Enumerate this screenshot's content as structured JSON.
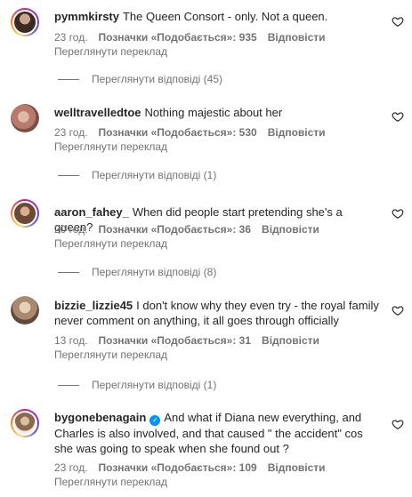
{
  "comments": [
    {
      "username": "pymmkirsty",
      "text": "The Queen Consort - only. Not a queen.",
      "time": "23 год.",
      "likes": "Позначки «Подобається»: 935",
      "reply": "Відповісти",
      "translate": "Переглянути переклад",
      "view_replies": "Переглянути відповіді (45)",
      "like_icon": "heart-outline-icon"
    },
    {
      "username": "welltravelledtoe",
      "text": "Nothing majestic about her",
      "time": "23 год.",
      "likes": "Позначки «Подобається»: 530",
      "reply": "Відповісти",
      "translate": "Переглянути переклад",
      "view_replies": "Переглянути відповіді (1)",
      "like_icon": "heart-outline-icon"
    },
    {
      "username": "aaron_fahey_",
      "text": "When did people start pretending she's a queen?",
      "time": "20 год.",
      "likes": "Позначки «Подобається»: 36",
      "reply": "Відповісти",
      "translate": "Переглянути переклад",
      "view_replies": "Переглянути відповіді (8)",
      "like_icon": "heart-outline-icon"
    },
    {
      "username": "bizzie_lizzie45",
      "text": "I don't know why they even try - the royal family never comment on anything, it all goes through officially",
      "time": "13 год.",
      "likes": "Позначки «Подобається»: 31",
      "reply": "Відповісти",
      "translate": "Переглянути переклад",
      "view_replies": "Переглянути відповіді (1)",
      "like_icon": "heart-outline-icon"
    },
    {
      "username": "bygonebenagain",
      "verified": "✓",
      "text": "And what if Diana new everything, and Charles is also involved, and that caused \" the accident\" cos she was going to speak when she found out ?",
      "time": "23 год.",
      "likes": "Позначки «Подобається»: 109",
      "reply": "Відповісти",
      "translate": "Переглянути переклад",
      "like_icon": "heart-outline-icon"
    }
  ],
  "colors": {
    "text": "#262626",
    "secondary": "#737373",
    "verified": "#0095f6"
  }
}
